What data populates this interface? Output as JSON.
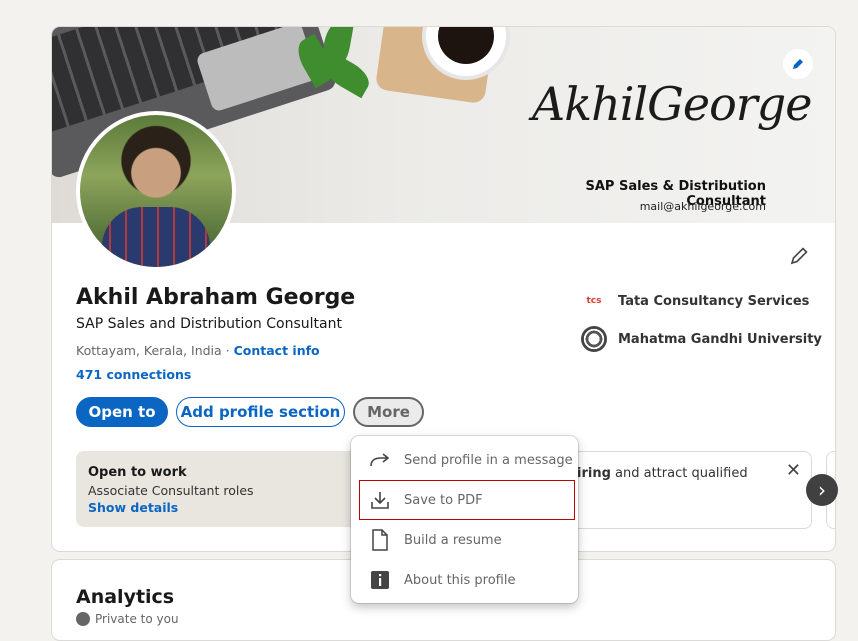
{
  "banner": {
    "signature": "AkhilGeorge",
    "role": "SAP Sales & Distribution Consultant",
    "email": "mail@akhilgeorge.com"
  },
  "profile": {
    "name": "Akhil Abraham George",
    "headline": "SAP Sales and Distribution Consultant",
    "location": "Kottayam, Kerala, India",
    "separator": " · ",
    "contact_label": "Contact info",
    "connections": "471 connections"
  },
  "buttons": {
    "open_to": "Open to",
    "add_section": "Add profile section",
    "more": "More"
  },
  "orgs": [
    {
      "name": "Tata Consultancy Services",
      "logo_text": "tcs"
    },
    {
      "name": "Mahatma Gandhi University"
    }
  ],
  "open_to_work": {
    "title": "Open to work",
    "subtitle": "Associate Consultant roles",
    "link": "Show details"
  },
  "hiring_card": {
    "text_bold": "iring",
    "text_rest": " and attract qualified"
  },
  "more_menu": {
    "items": [
      {
        "label": "Send profile in a message",
        "icon": "share-arrow-icon"
      },
      {
        "label": "Save to PDF",
        "icon": "download-icon"
      },
      {
        "label": "Build a resume",
        "icon": "document-icon"
      },
      {
        "label": "About this profile",
        "icon": "info-icon"
      }
    ]
  },
  "analytics": {
    "title": "Analytics",
    "subtitle": "Private to you"
  },
  "colors": {
    "accent": "#0a66c2",
    "highlight": "#c00000"
  }
}
